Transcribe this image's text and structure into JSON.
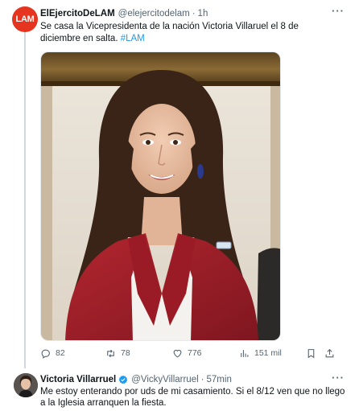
{
  "main_tweet": {
    "author_name": "ElEjercitoDeLAM",
    "author_handle": "@elejercitodelam",
    "separator": "·",
    "time": "1h",
    "avatar_text": "LAM",
    "text": "Se casa la Vicepresidenta de la nación Victoria Villaruel el 8 de diciembre en salta. ",
    "hashtag": "#LAM",
    "more_icon": "more-icon",
    "media": "photo-of-woman-in-red-blazer",
    "actions": {
      "replies": "82",
      "retweets": "78",
      "likes": "776",
      "views": "151 mil"
    }
  },
  "reply_tweet": {
    "author_name": "Victoria Villarruel",
    "verified_icon": "verified-badge-icon",
    "author_handle": "@VickyVillarruel",
    "separator": "·",
    "time": "57min",
    "text": "Me estoy enterando por uds de mi casamiento. Si el 8/12 ven que no llego a la Iglesia arranquen la fiesta."
  },
  "colors": {
    "accent": "#1d9bf0",
    "secondary_text": "#536471",
    "lam_avatar": "#e5341f",
    "blazer": "#a3202c"
  }
}
